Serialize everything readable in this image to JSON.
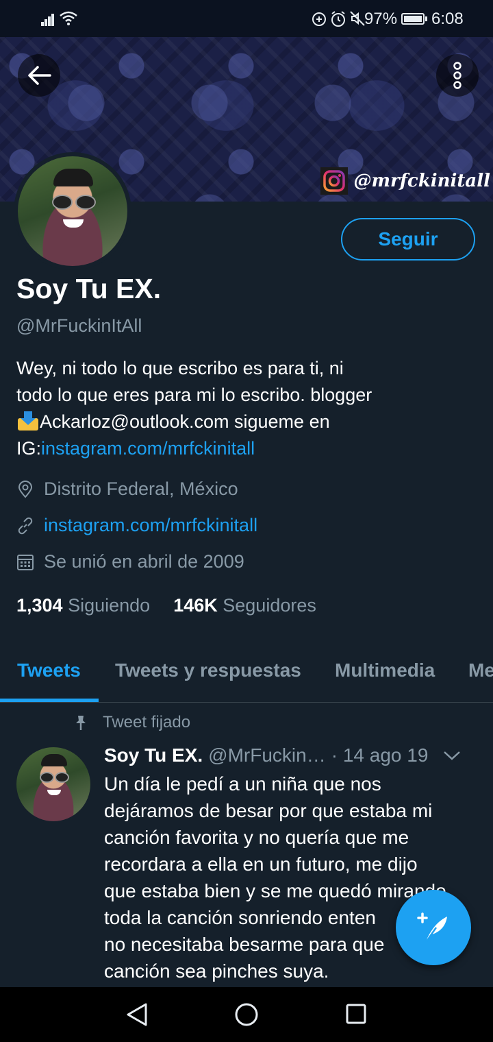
{
  "status_bar": {
    "battery": "97%",
    "time": "6:08"
  },
  "banner": {
    "instagram_tag": "@mrfckinitall"
  },
  "profile": {
    "follow_label": "Seguir",
    "display_name": "Soy Tu EX.",
    "handle": "@MrFuckinItAll",
    "bio_line1": "Wey, ni todo lo que escribo es para ti, ni",
    "bio_line2": "todo lo que eres para mi lo escribo. blogger",
    "bio_email_line": "Ackarloz@outlook.com sigueme en",
    "bio_ig_prefix": "IG:",
    "bio_ig_link": "instagram.com/mrfckinitall",
    "location": "Distrito Federal, México",
    "website": "instagram.com/mrfckinitall",
    "joined": "Se unió en abril de 2009",
    "following_count": "1,304",
    "following_label": "Siguiendo",
    "followers_count": "146K",
    "followers_label": "Seguidores"
  },
  "tabs": [
    "Tweets",
    "Tweets y respuestas",
    "Multimedia",
    "Me"
  ],
  "pinned_tweet": {
    "pinned_label": "Tweet fijado",
    "name": "Soy Tu EX.",
    "handle": "@MrFuckin…",
    "date": "· 14 ago 19",
    "text_lines": [
      "Un día le pedí a un niña que nos",
      "dejáramos de besar por que estaba mi",
      "canción favorita y no quería que me",
      "recordara a ella en un futuro, me dijo",
      "que estaba bien y se me quedó mirando",
      "toda la canción sonriendo enten",
      "no necesitaba besarme para que",
      "canción sea pinches suya."
    ]
  },
  "colors": {
    "background": "#15202b",
    "accent": "#1da1f2",
    "muted": "#8899a6"
  }
}
